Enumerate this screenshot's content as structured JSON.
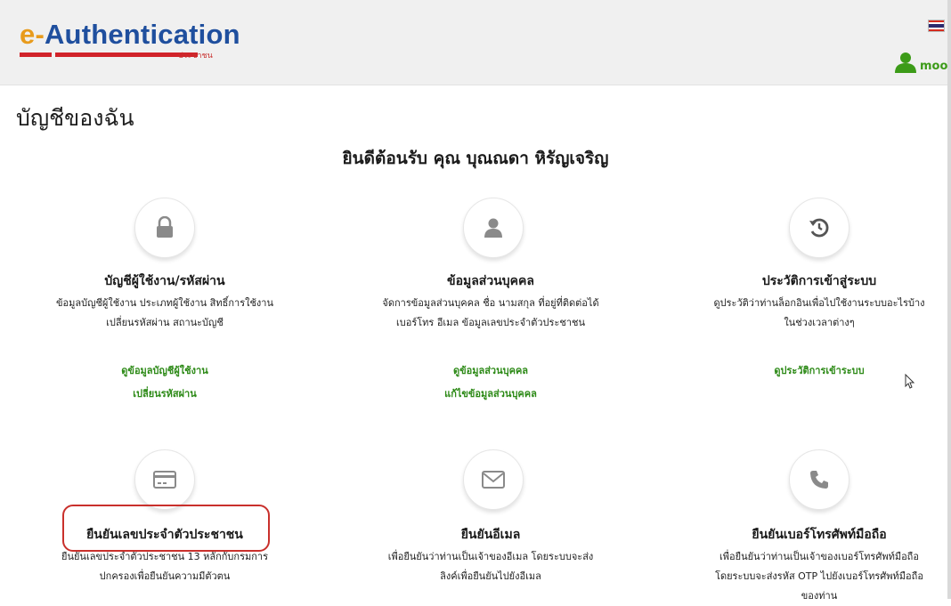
{
  "header": {
    "logo_prefix": "e-",
    "logo_main": "Authentication",
    "logo_sub": "ประชาชน",
    "username": "moop"
  },
  "page": {
    "title": "บัญชีของฉัน",
    "welcome": "ยินดีต้อนรับ คุณ บุณณดา หิรัญเจริญ"
  },
  "cards": [
    {
      "title": "บัญชีผู้ใช้งาน/รหัสผ่าน",
      "desc_1": "ข้อมูลบัญชีผู้ใช้งาน ประเภทผู้ใช้งาน สิทธิ์การใช้งาน",
      "desc_2": "เปลี่ยนรหัสผ่าน สถานะบัญชี",
      "link_1": "ดูข้อมูลบัญชีผู้ใช้งาน",
      "link_2": "เปลี่ยนรหัสผ่าน",
      "icon": "lock-icon"
    },
    {
      "title": "ข้อมูลส่วนบุคคล",
      "desc_1": "จัดการข้อมูลส่วนบุคคล ชื่อ นามสกุล ที่อยู่ที่ติดต่อได้",
      "desc_2": "เบอร์โทร อีเมล ข้อมูลเลขประจำตัวประชาชน",
      "link_1": "ดูข้อมูลส่วนบุคคล",
      "link_2": "แก้ไขข้อมูลส่วนบุคคล",
      "icon": "user-icon"
    },
    {
      "title": "ประวัติการเข้าสู่ระบบ",
      "desc_1": "ดูประวัติว่าท่านล็อกอินเพื่อไปใช้งานระบบอะไรบ้าง",
      "desc_2": "ในช่วงเวลาต่างๆ",
      "link_1": "ดูประวัติการเข้าระบบ",
      "icon": "history-icon"
    },
    {
      "title": "ยืนยันเลขประจำตัวประชาชน",
      "desc_1": "ยืนยันเลขประจำตัวประชาชน 13 หลักกับกรมการ",
      "desc_2": "ปกครองเพื่อยืนยันความมีตัวตน",
      "icon": "id-card-icon"
    },
    {
      "title": "ยืนยันอีเมล",
      "desc_1": "เพื่อยืนยันว่าท่านเป็นเจ้าของอีเมล โดยระบบจะส่ง",
      "desc_2": "ลิงค์เพื่อยืนยันไปยังอีเมล",
      "icon": "envelope-icon"
    },
    {
      "title": "ยืนยันเบอร์โทรศัพท์มือถือ",
      "desc_1": "เพื่อยืนยันว่าท่านเป็นเจ้าของเบอร์โทรศัพท์มือถือ",
      "desc_2": "โดยระบบจะส่งรหัส OTP ไปยังเบอร์โทรศัพท์มือถือ",
      "desc_3": "ของท่าน",
      "icon": "phone-icon"
    }
  ],
  "colors": {
    "brand_blue": "#1f4f9e",
    "brand_orange": "#e89b1c",
    "link_green": "#2d8a17",
    "highlight_red": "#c9302c",
    "icon_grey": "#8a8a8a"
  }
}
